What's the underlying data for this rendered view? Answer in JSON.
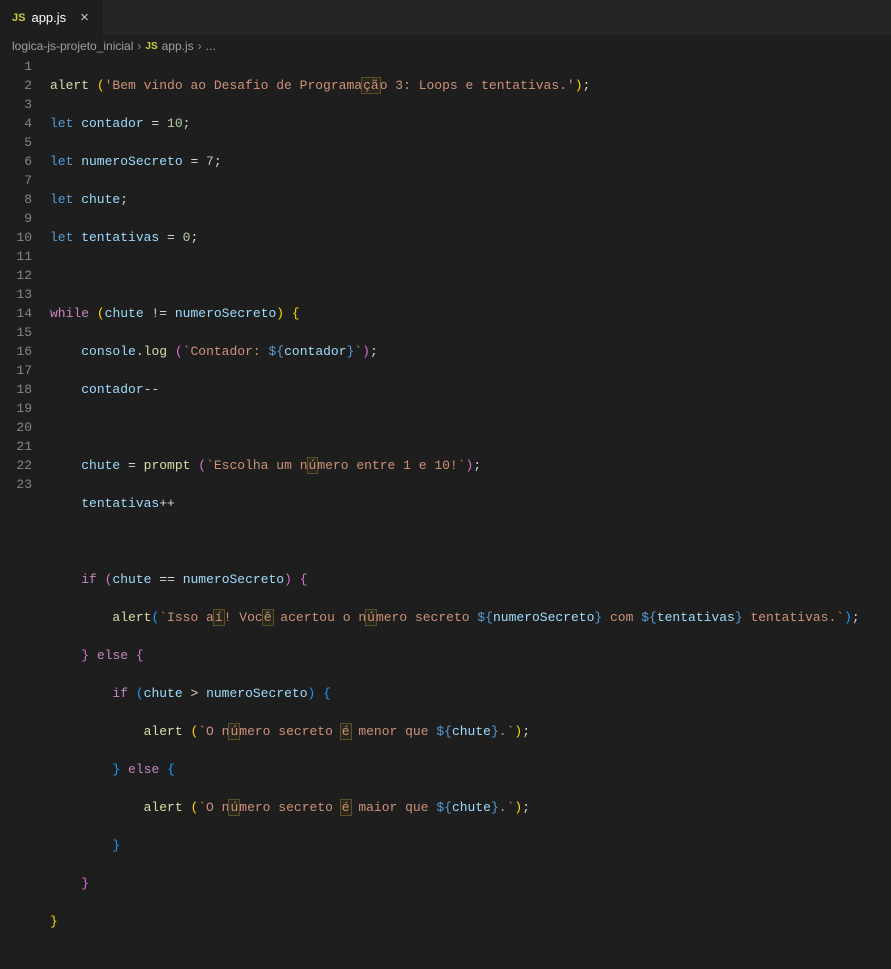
{
  "tab": {
    "icon": "JS",
    "name": "app.js",
    "close": "×"
  },
  "breadcrumb": {
    "folder": "logica-js-projeto_inicial",
    "sep": "›",
    "icon": "JS",
    "file": "app.js",
    "ellipsis": "..."
  },
  "lines": [
    "1",
    "2",
    "3",
    "4",
    "5",
    "6",
    "7",
    "8",
    "9",
    "10",
    "11",
    "12",
    "13",
    "14",
    "15",
    "16",
    "17",
    "18",
    "19",
    "20",
    "21",
    "22",
    "23"
  ],
  "code": {
    "l1_alert": "alert ",
    "l1_str1": "'Bem vindo ao Desafio de Programa",
    "l1_hl1": "çã",
    "l1_str2": "o 3: Loops e tentativas.'",
    "l2_let": "let",
    "l2_var": " contador ",
    "l2_eq": "= ",
    "l2_num": "10",
    "l3_var": " numeroSecreto ",
    "l3_num": "7",
    "l4_var": " chute",
    "l5_var": " tentativas ",
    "l5_num": "0",
    "l7_while": "while",
    "l7_chute": "chute",
    "l7_neq": " != ",
    "l7_ns": "numeroSecreto",
    "l8_console": "console",
    "l8_log": "log ",
    "l8_str1": "`Contador: ",
    "l8_tpl_o": "${",
    "l8_tpl_v": "contador",
    "l8_tpl_c": "}",
    "l8_str2": "`",
    "l9_var": "contador",
    "l9_op": "--",
    "l11_chute": "chute",
    "l11_prompt": "prompt ",
    "l11_str1": "`Escolha um n",
    "l11_hl": "ú",
    "l11_str2": "mero entre 1 e 10!`",
    "l12_var": "tentativas",
    "l12_op": "++",
    "l14_if": "if",
    "l14_eq": " == ",
    "l15_alert": "alert",
    "l15_s1": "`Isso a",
    "l15_h1": "í",
    "l15_s2": "! Voc",
    "l15_h2": "ê",
    "l15_s3": " acertou o n",
    "l15_h3": "ú",
    "l15_s4": "mero secreto ",
    "l15_v1": "numeroSecreto",
    "l15_s5": " com ",
    "l15_v2": "tentativas",
    "l15_s6": " tentativas.`",
    "l16_else": "else",
    "l17_gt": " > ",
    "l18_alert": "alert ",
    "l18_s1": "`O n",
    "l18_h1": "ú",
    "l18_s2": "mero secreto ",
    "l18_h2": "é",
    "l18_s3": " menor que ",
    "l18_v": "chute",
    "l18_s4": ".`",
    "l19_else": "else",
    "l20_s3": " maior que "
  }
}
